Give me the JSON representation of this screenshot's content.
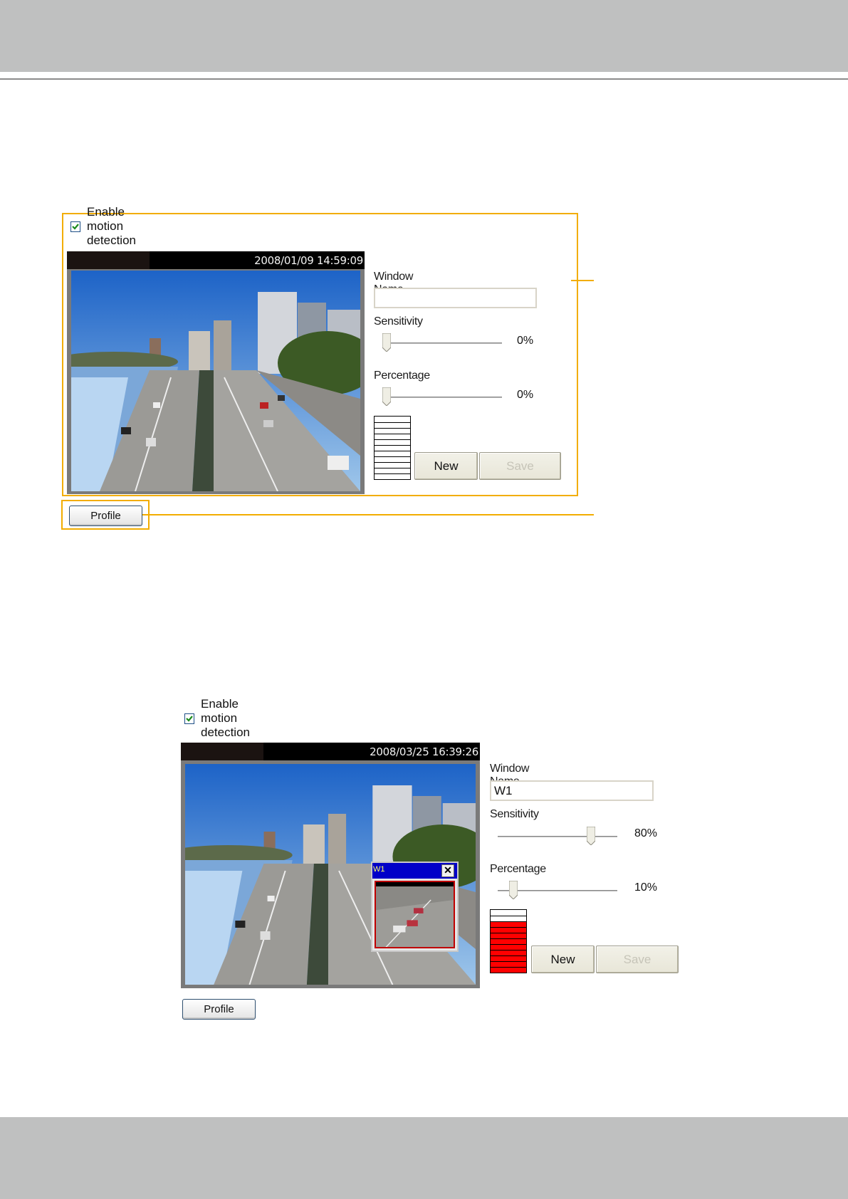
{
  "panels": [
    {
      "enable_label": "Enable motion detection",
      "enabled": true,
      "timestamp": "2008/01/09 14:59:09",
      "window_name_label": "Window Name",
      "window_name_value": "",
      "sensitivity_label": "Sensitivity",
      "sensitivity_value": "0%",
      "sensitivity_fraction": 0.0,
      "percentage_label": "Percentage",
      "percentage_value": "0%",
      "percentage_fraction": 0.0,
      "meter_filled_cells": 0,
      "meter_total_cells": 11,
      "new_label": "New",
      "save_label": "Save",
      "profile_label": "Profile"
    },
    {
      "enable_label": "Enable motion detection",
      "enabled": true,
      "timestamp": "2008/03/25 16:39:26",
      "window_name_label": "Window Name",
      "window_name_value": "W1",
      "sensitivity_label": "Sensitivity",
      "sensitivity_value": "80%",
      "sensitivity_fraction": 0.8,
      "percentage_label": "Percentage",
      "percentage_value": "10%",
      "percentage_fraction": 0.1,
      "meter_filled_cells": 9,
      "meter_total_cells": 11,
      "motion_window_name": "W1",
      "new_label": "New",
      "save_label": "Save",
      "profile_label": "Profile"
    }
  ],
  "colors": {
    "callout": "#f2ad00",
    "meter_active": "#ff0000",
    "motion_window_title": "#0000c8"
  }
}
